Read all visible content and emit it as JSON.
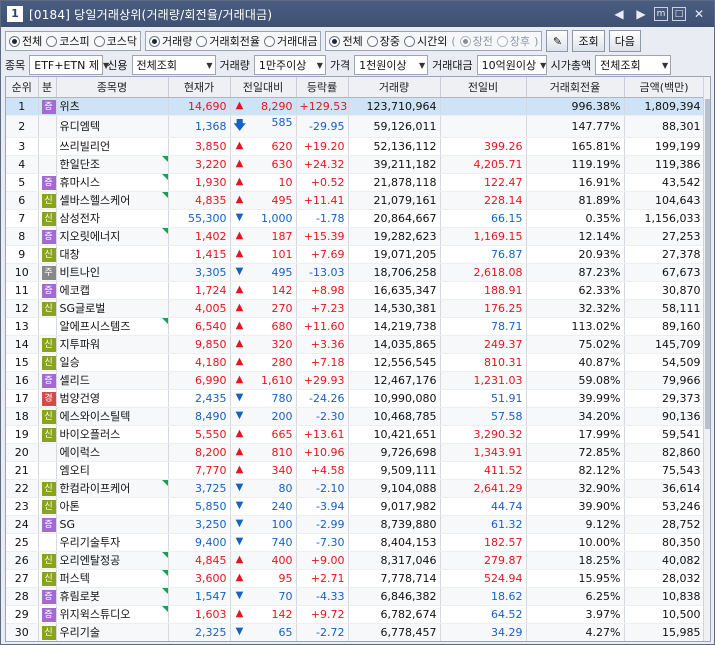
{
  "window": {
    "screen_no": "1",
    "title": "[0184] 당일거래상위(거래량/회전율/거래대금)",
    "controls": [
      "◀",
      "▶",
      "m",
      "□",
      "✕"
    ]
  },
  "filters": {
    "market": {
      "options": [
        "전체",
        "코스피",
        "코스닥"
      ],
      "selected": 0
    },
    "sort_by": {
      "options": [
        "거래량",
        "거래회전율",
        "거래대금"
      ],
      "selected": 0
    },
    "session": {
      "options": [
        "전체",
        "장중",
        "시간외"
      ],
      "selected": 0,
      "sub": [
        "장전",
        "장후"
      ],
      "sub_selected": 0
    },
    "buttons": {
      "lookup": "조회",
      "next": "다음"
    },
    "item_label": "종목",
    "item_value": "ETF+ETN 제",
    "credit_label": "신용",
    "credit_value": "전체조회",
    "volume_label": "거래량",
    "volume_value": "1만주이상",
    "price_label": "가격",
    "price_value": "1천원이상",
    "amount_label": "거래대금",
    "amount_value": "10억원이상",
    "mcap_label": "시가총액",
    "mcap_value": "전체조회"
  },
  "columns": [
    "순위",
    "분",
    "종목명",
    "현재가",
    "전일대비",
    "등락률",
    "거래량",
    "전일비",
    "거래회전율",
    "금액(백만)"
  ],
  "rows": [
    {
      "rank": "1",
      "badge": "증",
      "name": "위츠",
      "price": "14,690",
      "dir": "up",
      "change": "8,290",
      "rate": "+129.53",
      "volume": "123,710,964",
      "prevratio": "",
      "turnover": "996.38%",
      "amount": "1,809,394",
      "flag": false,
      "selected": true
    },
    {
      "rank": "2",
      "badge": "",
      "name": "유디엠텍",
      "price": "1,368",
      "dir": "lim",
      "change": "585",
      "rate": "-29.95",
      "volume": "59,126,011",
      "prevratio": "",
      "turnover": "147.77%",
      "amount": "88,301",
      "flag": false
    },
    {
      "rank": "3",
      "badge": "",
      "name": "쓰리빌리언",
      "price": "3,850",
      "dir": "up",
      "change": "620",
      "rate": "+19.20",
      "volume": "52,136,112",
      "prevratio": "399.26",
      "turnover": "165.81%",
      "amount": "199,199",
      "flag": false
    },
    {
      "rank": "4",
      "badge": "",
      "name": "한일단조",
      "price": "3,220",
      "dir": "up",
      "change": "630",
      "rate": "+24.32",
      "volume": "39,211,182",
      "prevratio": "4,205.71",
      "turnover": "119.19%",
      "amount": "119,386",
      "flag": true
    },
    {
      "rank": "5",
      "badge": "증",
      "name": "휴마시스",
      "price": "1,930",
      "dir": "up",
      "change": "10",
      "rate": "+0.52",
      "volume": "21,878,118",
      "prevratio": "122.47",
      "turnover": "16.91%",
      "amount": "43,542",
      "flag": true
    },
    {
      "rank": "6",
      "badge": "신",
      "name": "셀바스헬스케어",
      "price": "4,835",
      "dir": "up",
      "change": "495",
      "rate": "+11.41",
      "volume": "21,079,161",
      "prevratio": "228.14",
      "turnover": "81.89%",
      "amount": "104,643",
      "flag": true
    },
    {
      "rank": "7",
      "badge": "신",
      "name": "삼성전자",
      "price": "55,300",
      "dir": "dn",
      "change": "1,000",
      "rate": "-1.78",
      "volume": "20,864,667",
      "prevratio": "66.15",
      "turnover": "0.35%",
      "amount": "1,156,033",
      "flag": false
    },
    {
      "rank": "8",
      "badge": "증",
      "name": "지오릿에너지",
      "price": "1,402",
      "dir": "up",
      "change": "187",
      "rate": "+15.39",
      "volume": "19,282,623",
      "prevratio": "1,169.15",
      "turnover": "12.14%",
      "amount": "27,253",
      "flag": true
    },
    {
      "rank": "9",
      "badge": "신",
      "name": "대창",
      "price": "1,415",
      "dir": "up",
      "change": "101",
      "rate": "+7.69",
      "volume": "19,071,205",
      "prevratio": "76.87",
      "turnover": "20.93%",
      "amount": "27,378",
      "flag": false
    },
    {
      "rank": "10",
      "badge": "주",
      "name": "비트나인",
      "price": "3,305",
      "dir": "dn",
      "change": "495",
      "rate": "-13.03",
      "volume": "18,706,258",
      "prevratio": "2,618.08",
      "turnover": "87.23%",
      "amount": "67,673",
      "flag": false
    },
    {
      "rank": "11",
      "badge": "증",
      "name": "에코캡",
      "price": "1,724",
      "dir": "up",
      "change": "142",
      "rate": "+8.98",
      "volume": "16,635,347",
      "prevratio": "188.91",
      "turnover": "62.33%",
      "amount": "30,870",
      "flag": false
    },
    {
      "rank": "12",
      "badge": "신",
      "name": "SG글로벌",
      "price": "4,005",
      "dir": "up",
      "change": "270",
      "rate": "+7.23",
      "volume": "14,530,381",
      "prevratio": "176.25",
      "turnover": "32.32%",
      "amount": "58,111",
      "flag": false
    },
    {
      "rank": "13",
      "badge": "",
      "name": "알에프시스템즈",
      "price": "6,540",
      "dir": "up",
      "change": "680",
      "rate": "+11.60",
      "volume": "14,219,738",
      "prevratio": "78.71",
      "turnover": "113.02%",
      "amount": "89,160",
      "flag": true
    },
    {
      "rank": "14",
      "badge": "신",
      "name": "지투파워",
      "price": "9,850",
      "dir": "up",
      "change": "320",
      "rate": "+3.36",
      "volume": "14,035,865",
      "prevratio": "249.37",
      "turnover": "75.02%",
      "amount": "145,709",
      "flag": false
    },
    {
      "rank": "15",
      "badge": "신",
      "name": "일승",
      "price": "4,180",
      "dir": "up",
      "change": "280",
      "rate": "+7.18",
      "volume": "12,556,545",
      "prevratio": "810.31",
      "turnover": "40.87%",
      "amount": "54,509",
      "flag": false
    },
    {
      "rank": "16",
      "badge": "증",
      "name": "셀리드",
      "price": "6,990",
      "dir": "up",
      "change": "1,610",
      "rate": "+29.93",
      "volume": "12,467,176",
      "prevratio": "1,231.03",
      "turnover": "59.08%",
      "amount": "79,966",
      "flag": false
    },
    {
      "rank": "17",
      "badge": "경",
      "name": "범양건영",
      "price": "2,435",
      "dir": "dn",
      "change": "780",
      "rate": "-24.26",
      "volume": "10,990,080",
      "prevratio": "51.91",
      "turnover": "39.99%",
      "amount": "29,373",
      "flag": false
    },
    {
      "rank": "18",
      "badge": "신",
      "name": "에스와이스틸텍",
      "price": "8,490",
      "dir": "dn",
      "change": "200",
      "rate": "-2.30",
      "volume": "10,468,785",
      "prevratio": "57.58",
      "turnover": "34.20%",
      "amount": "90,136",
      "flag": false
    },
    {
      "rank": "19",
      "badge": "신",
      "name": "바이오플러스",
      "price": "5,550",
      "dir": "up",
      "change": "665",
      "rate": "+13.61",
      "volume": "10,421,651",
      "prevratio": "3,290.32",
      "turnover": "17.99%",
      "amount": "59,541",
      "flag": false
    },
    {
      "rank": "20",
      "badge": "",
      "name": "에이럭스",
      "price": "8,200",
      "dir": "up",
      "change": "810",
      "rate": "+10.96",
      "volume": "9,726,698",
      "prevratio": "1,343.91",
      "turnover": "72.85%",
      "amount": "82,860",
      "flag": false
    },
    {
      "rank": "21",
      "badge": "",
      "name": "엠오티",
      "price": "7,770",
      "dir": "up",
      "change": "340",
      "rate": "+4.58",
      "volume": "9,509,111",
      "prevratio": "411.52",
      "turnover": "82.12%",
      "amount": "75,543",
      "flag": false
    },
    {
      "rank": "22",
      "badge": "신",
      "name": "한컴라이프케어",
      "price": "3,725",
      "dir": "dn",
      "change": "80",
      "rate": "-2.10",
      "volume": "9,104,088",
      "prevratio": "2,641.29",
      "turnover": "32.90%",
      "amount": "36,614",
      "flag": true
    },
    {
      "rank": "23",
      "badge": "신",
      "name": "아톤",
      "price": "5,850",
      "dir": "dn",
      "change": "240",
      "rate": "-3.94",
      "volume": "9,017,982",
      "prevratio": "44.74",
      "turnover": "39.90%",
      "amount": "53,246",
      "flag": false
    },
    {
      "rank": "24",
      "badge": "증",
      "name": "SG",
      "price": "3,250",
      "dir": "dn",
      "change": "100",
      "rate": "-2.99",
      "volume": "8,739,880",
      "prevratio": "61.32",
      "turnover": "9.12%",
      "amount": "28,752",
      "flag": false
    },
    {
      "rank": "25",
      "badge": "",
      "name": "우리기술투자",
      "price": "9,400",
      "dir": "dn",
      "change": "740",
      "rate": "-7.30",
      "volume": "8,404,153",
      "prevratio": "182.57",
      "turnover": "10.00%",
      "amount": "80,350",
      "flag": false
    },
    {
      "rank": "26",
      "badge": "신",
      "name": "오리엔탈정공",
      "price": "4,845",
      "dir": "up",
      "change": "400",
      "rate": "+9.00",
      "volume": "8,317,046",
      "prevratio": "279.87",
      "turnover": "18.25%",
      "amount": "40,082",
      "flag": true
    },
    {
      "rank": "27",
      "badge": "신",
      "name": "퍼스텍",
      "price": "3,600",
      "dir": "up",
      "change": "95",
      "rate": "+2.71",
      "volume": "7,778,714",
      "prevratio": "524.94",
      "turnover": "15.95%",
      "amount": "28,032",
      "flag": true
    },
    {
      "rank": "28",
      "badge": "증",
      "name": "휴림로봇",
      "price": "1,547",
      "dir": "dn",
      "change": "70",
      "rate": "-4.33",
      "volume": "6,846,382",
      "prevratio": "18.62",
      "turnover": "6.25%",
      "amount": "10,838",
      "flag": true
    },
    {
      "rank": "29",
      "badge": "증",
      "name": "위지윅스튜디오",
      "price": "1,603",
      "dir": "up",
      "change": "142",
      "rate": "+9.72",
      "volume": "6,782,674",
      "prevratio": "64.52",
      "turnover": "3.97%",
      "amount": "10,500",
      "flag": true
    },
    {
      "rank": "30",
      "badge": "신",
      "name": "우리기술",
      "price": "2,325",
      "dir": "dn",
      "change": "65",
      "rate": "-2.72",
      "volume": "6,778,457",
      "prevratio": "34.29",
      "turnover": "4.27%",
      "amount": "15,985",
      "flag": false
    }
  ],
  "colors": {
    "up": "#e8141d",
    "down": "#1462c4",
    "selected_row": "#cfe3f6"
  },
  "icons": {
    "direction_up": "▲",
    "direction_down": "▼",
    "limit_down": "🡇"
  }
}
